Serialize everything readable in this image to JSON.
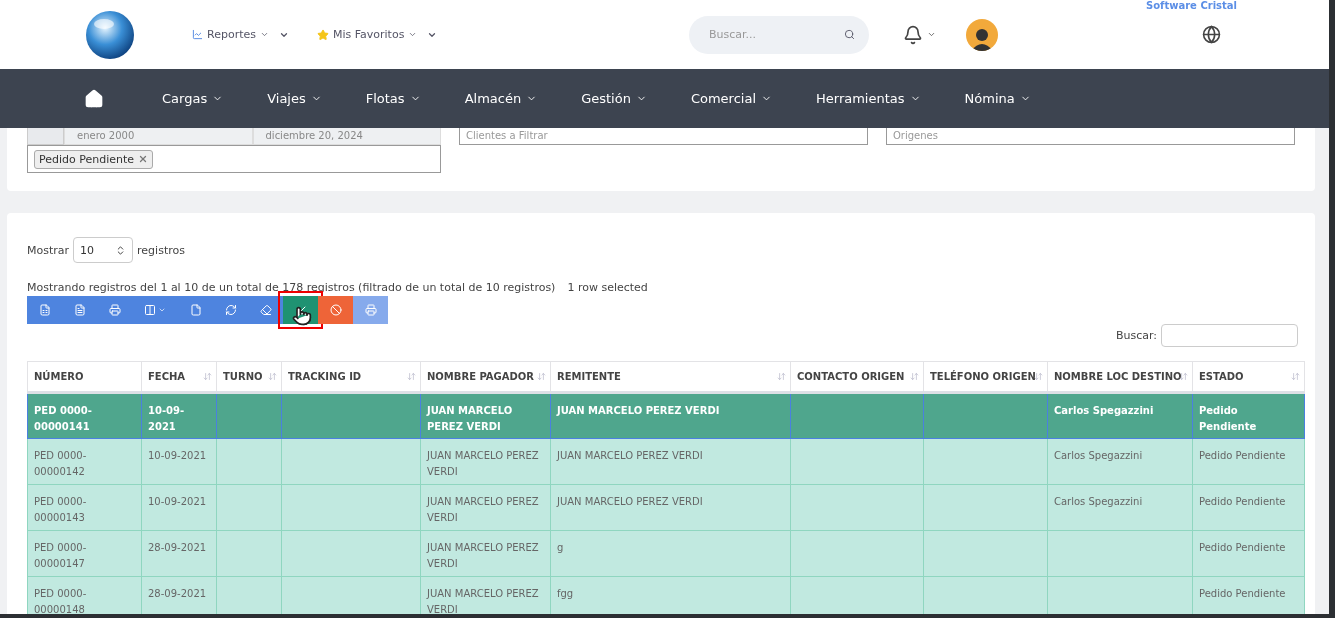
{
  "header": {
    "brand": "Software Cristal",
    "menus": [
      {
        "kind": "chart",
        "label": "Reportes"
      },
      {
        "kind": "star",
        "label": "Mis Favoritos"
      }
    ],
    "search": {
      "placeholder": "Buscar..."
    }
  },
  "nav": {
    "items": [
      "Cargas",
      "Viajes",
      "Flotas",
      "Almacén",
      "Gestión",
      "Comercial",
      "Herramientas",
      "Nómina"
    ]
  },
  "filters": {
    "date_from": "enero 2000",
    "date_to": "diciembre 20, 2024",
    "tags": [
      "Pedido Pendiente"
    ],
    "clients_placeholder": "Clientes a Filtrar",
    "origins_placeholder": "Origenes"
  },
  "table_controls": {
    "show_label": "Mostrar",
    "page_size": "10",
    "records_label": "registros",
    "info": "Mostrando registros del 1 al 10 de un total de 178 registros (filtrado de un total de 10 registros)",
    "selection_info": "1 row selected",
    "search_label": "Buscar:"
  },
  "toolbar": [
    {
      "kind": "excel",
      "highlighted": false
    },
    {
      "kind": "pdf",
      "highlighted": false
    },
    {
      "kind": "print",
      "highlighted": false
    },
    {
      "kind": "columns",
      "highlighted": false
    },
    {
      "kind": "csv",
      "highlighted": false
    },
    {
      "kind": "refresh",
      "highlighted": false
    },
    {
      "kind": "erase",
      "highlighted": false
    },
    {
      "kind": "approve",
      "highlighted": true
    },
    {
      "kind": "cancel",
      "highlighted": false
    },
    {
      "kind": "print-light",
      "highlighted": false
    }
  ],
  "table": {
    "columns": [
      "NÚMERO",
      "FECHA",
      "TURNO",
      "TRACKING ID",
      "NOMBRE PAGADOR",
      "REMITENTE",
      "CONTACTO ORIGEN",
      "TELÉFONO ORIGEN",
      "NOMBRE LOC DESTINO",
      "ESTADO"
    ],
    "rows": [
      {
        "selected": true,
        "cells": [
          "PED 0000-00000141",
          "10-09-2021",
          "",
          "",
          "JUAN MARCELO PEREZ VERDI",
          "JUAN MARCELO PEREZ VERDI",
          "",
          "",
          "Carlos Spegazzini",
          "Pedido Pendiente"
        ]
      },
      {
        "selected": false,
        "cells": [
          "PED 0000-00000142",
          "10-09-2021",
          "",
          "",
          "JUAN MARCELO PEREZ VERDI",
          "JUAN MARCELO PEREZ VERDI",
          "",
          "",
          "Carlos Spegazzini",
          "Pedido Pendiente"
        ]
      },
      {
        "selected": false,
        "cells": [
          "PED 0000-00000143",
          "10-09-2021",
          "",
          "",
          "JUAN MARCELO PEREZ VERDI",
          "JUAN MARCELO PEREZ VERDI",
          "",
          "",
          "Carlos Spegazzini",
          "Pedido Pendiente"
        ]
      },
      {
        "selected": false,
        "cells": [
          "PED 0000-00000147",
          "28-09-2021",
          "",
          "",
          "JUAN MARCELO PEREZ VERDI",
          "g",
          "",
          "",
          "",
          "Pedido Pendiente"
        ]
      },
      {
        "selected": false,
        "cells": [
          "PED 0000-00000148",
          "28-09-2021",
          "",
          "",
          "JUAN MARCELO PEREZ VERDI",
          "fgg",
          "",
          "",
          "",
          "Pedido Pendiente"
        ]
      }
    ]
  }
}
